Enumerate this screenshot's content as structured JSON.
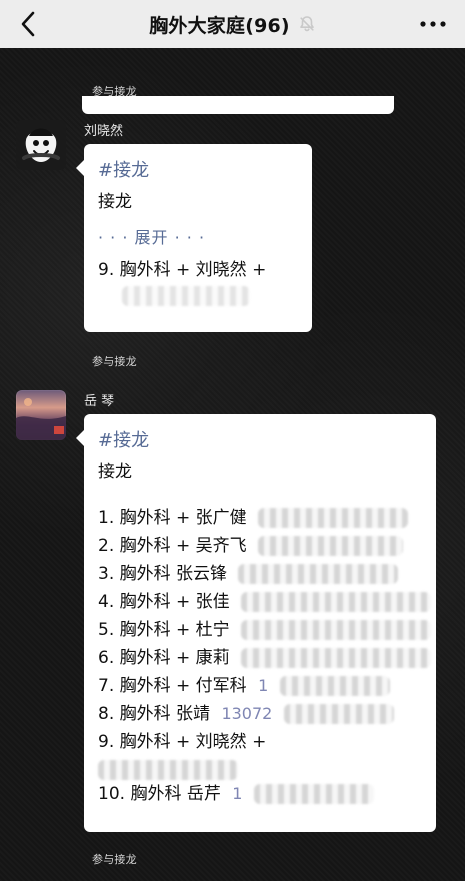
{
  "header": {
    "title": "胸外大家庭(96)",
    "back_icon": "chevron-left-icon",
    "mute_icon": "bell-muted-icon",
    "more_icon": "more-horizontal-icon"
  },
  "system_labels": {
    "participate_1": "参与接龙",
    "participate_2": "参与接龙",
    "participate_3": "参与接龙"
  },
  "messages": [
    {
      "sender": "刘晓然",
      "hashtag": "#接龙",
      "title": "接龙",
      "expand_text": "· · · 展开 · · ·",
      "lines": [
        "9. 胸外科 + 刘晓然 +"
      ]
    },
    {
      "sender": "岳 琴",
      "hashtag": "#接龙",
      "title": "接龙",
      "lines": [
        "1. 胸外科 + 张广健",
        "2. 胸外科 + 吴齐飞",
        "3. 胸外科 张云锋",
        "4. 胸外科 + 张佳",
        "5. 胸外科 + 杜宁",
        "6. 胸外科 + 康莉",
        "7. 胸外科 + 付军科",
        "8. 胸外科 张靖",
        "9. 胸外科 + 刘晓然 +",
        "10. 胸外科 岳芹"
      ],
      "visible_number_fragments": {
        "line_7": "1",
        "line_8": "13072",
        "line_10": "1"
      }
    }
  ],
  "colors": {
    "header_bg": "#ededed",
    "chat_bg": "#151515",
    "bubble_bg": "#ffffff",
    "link_blue": "#576b95"
  }
}
